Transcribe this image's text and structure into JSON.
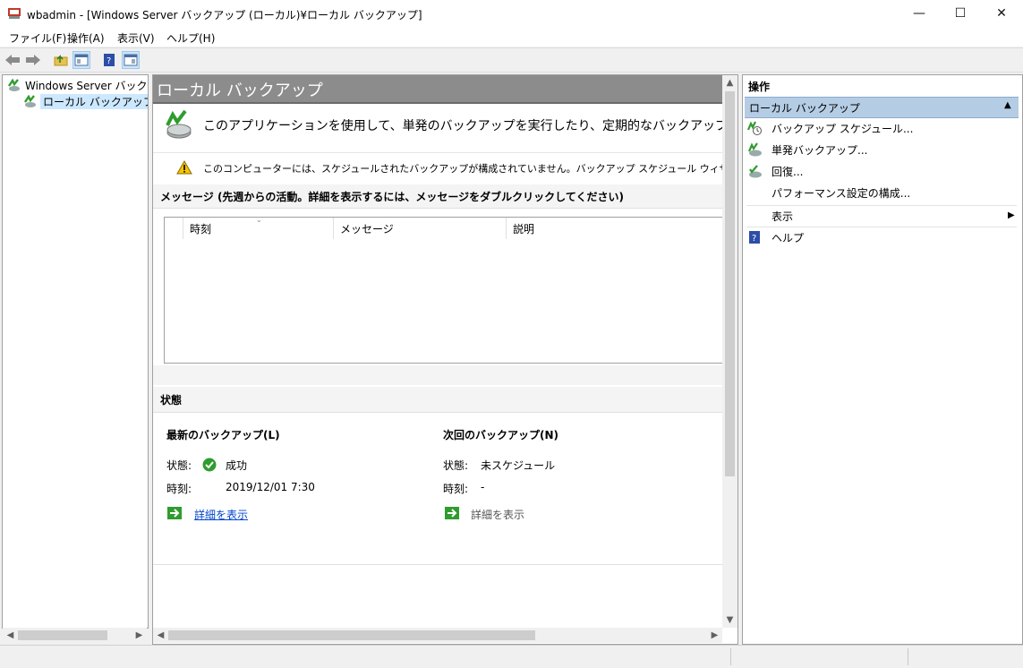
{
  "window": {
    "title": "wbadmin - [Windows Server バックアップ (ローカル)¥ローカル バックアップ]",
    "minimize": "—",
    "maximize": "☐",
    "close": "✕"
  },
  "menu": [
    "ファイル(F)",
    "操作(A)",
    "表示(V)",
    "ヘルプ(H)"
  ],
  "tree": {
    "root": "Windows Server バックアップ (ローカル)",
    "child": "ローカル バックアップ"
  },
  "center": {
    "header": "ローカル バックアップ",
    "intro": "このアプリケーションを使用して、単発のバックアップを実行したり、定期的なバックアップのスケジュールを作成したりできます。",
    "warning": "このコンピューターには、スケジュールされたバックアップが構成されていません。バックアップ スケジュール ウィザードを使用すると、定期的なバックアップを構成できます。",
    "messages_heading": "メッセージ (先週からの活動。詳細を表示するには、メッセージをダブルクリックしてください)",
    "columns": [
      "時刻",
      "メッセージ",
      "説明"
    ],
    "status_heading": "状態",
    "latest": {
      "heading": "最新のバックアップ(L)",
      "status_label": "状態:",
      "status_value": "成功",
      "time_label": "時刻:",
      "time_value": "2019/12/01 7:30",
      "details": "詳細を表示"
    },
    "next": {
      "heading": "次回のバックアップ(N)",
      "status_label": "状態:",
      "status_value": "未スケジュール",
      "time_label": "時刻:",
      "time_value": "-",
      "details": "詳細を表示"
    }
  },
  "actions": {
    "heading": "操作",
    "subheading": "ローカル バックアップ",
    "items": [
      "バックアップ スケジュール...",
      "単発バックアップ...",
      "回復...",
      "パフォーマンス設定の構成...",
      "表示",
      "ヘルプ"
    ]
  },
  "colors": {
    "accent": "#b5cde4",
    "header_gray": "#8c8c8c",
    "link": "#0044cc"
  }
}
